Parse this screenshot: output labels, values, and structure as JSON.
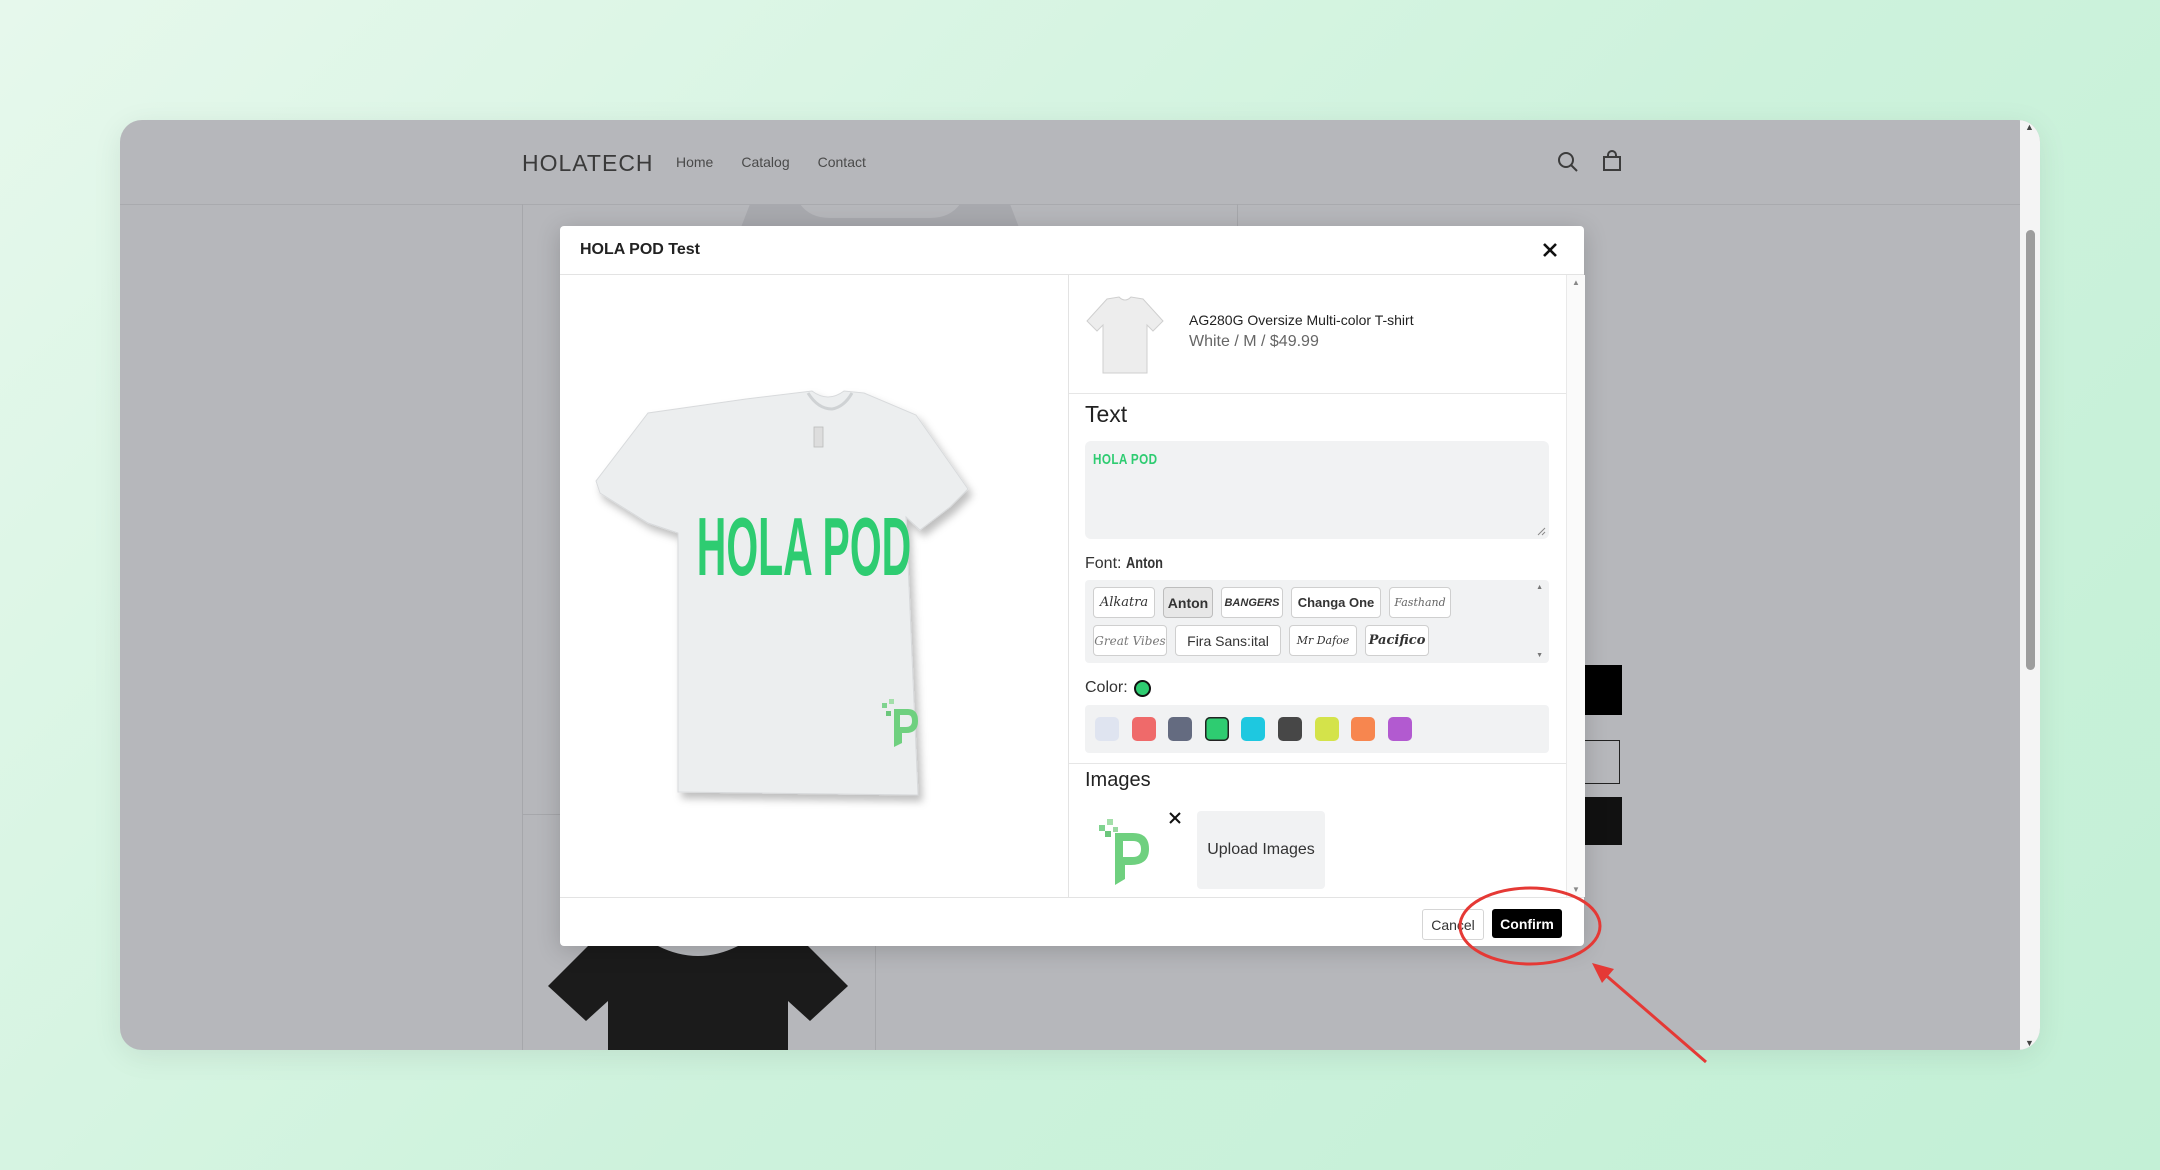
{
  "store": {
    "brand": "HOLATECH",
    "nav": [
      "Home",
      "Catalog",
      "Contact"
    ]
  },
  "modal": {
    "title": "HOLA POD Test",
    "product": {
      "name": "AG280G Oversize Multi-color T-shirt",
      "meta": "White / M / $49.99"
    },
    "text_section": {
      "title": "Text",
      "value": "HOLA POD"
    },
    "font": {
      "label": "Font:",
      "selected": "Anton",
      "options": [
        "Alkatra",
        "Anton",
        "BANGERS",
        "Changa One",
        "Fasthand",
        "Great Vibes",
        "Fira Sans:ital",
        "Mr Dafoe",
        "Pacifico"
      ]
    },
    "color": {
      "label": "Color:",
      "selected": "#2ecc71",
      "swatches": [
        "#dfe4f0",
        "#ef6a6a",
        "#646b80",
        "#2ecc71",
        "#1ec8e0",
        "#474747",
        "#d4e34a",
        "#f7864f",
        "#b25ad0"
      ]
    },
    "images_section": {
      "title": "Images",
      "upload_label": "Upload Images"
    },
    "footer": {
      "cancel": "Cancel",
      "confirm": "Confirm"
    },
    "preview_print": "HOLA POD"
  },
  "annotation_color": "#e53935"
}
